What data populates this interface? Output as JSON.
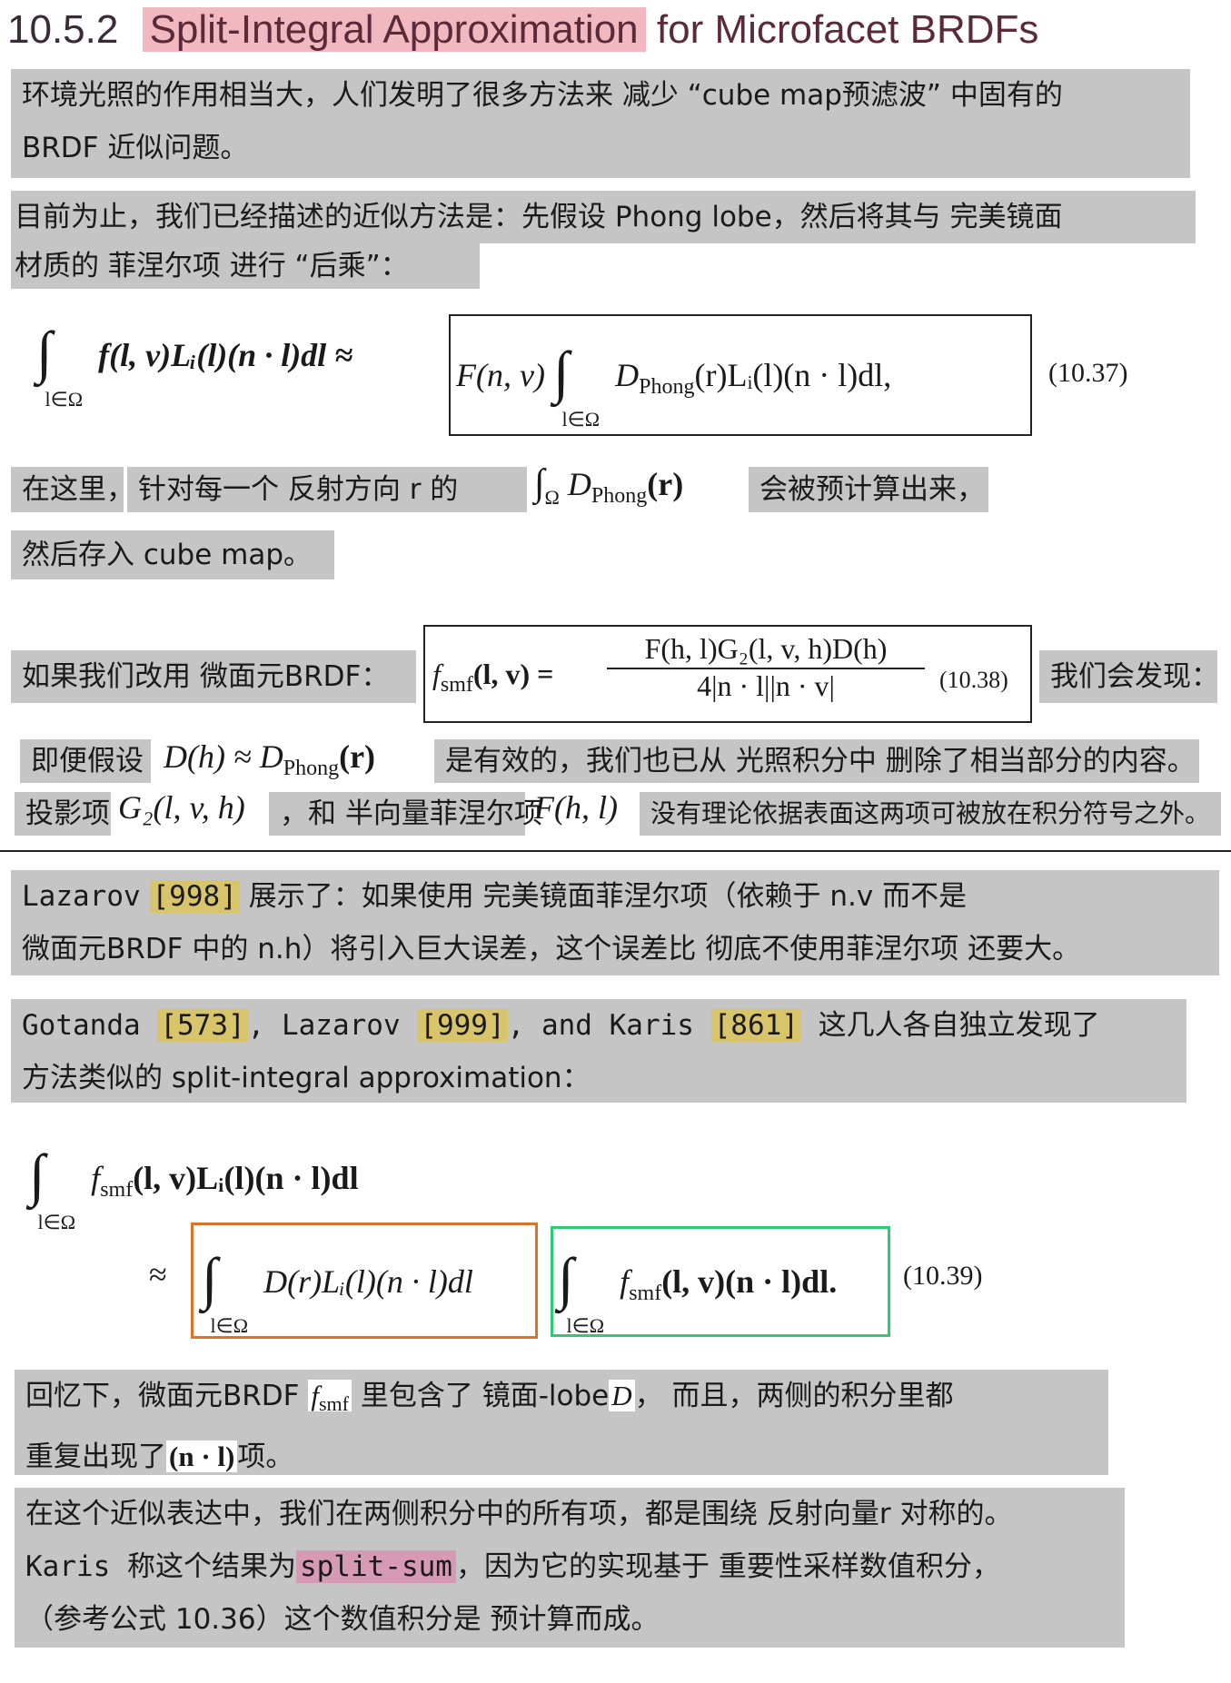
{
  "heading": {
    "number": "10.5.2",
    "title_highlight": "Split-Integral Approximation",
    "title_rest": "for Microfacet BRDFs"
  },
  "p1": {
    "line1": "环境光照的作用相当大，人们发明了很多方法来 减少 “cube map预滤波” 中固有的",
    "line2": "BRDF 近似问题。"
  },
  "p2": {
    "line1": "目前为止，我们已经描述的近似方法是：先假设 Phong lobe，然后将其与 完美镜面",
    "line2": "材质的 菲涅尔项 进行 “后乘”："
  },
  "eq1": {
    "lhs": "f(l, v)Lᵢ(l)(n · l)dl ≈",
    "int_sub": "l∈Ω",
    "box_prefix": "F(n, v)",
    "box_body_pre": "D",
    "box_body_sub": "Phong",
    "box_body_post": "(r)Lᵢ(l)(n · l)dl,",
    "number": "(10.37)"
  },
  "p3": {
    "seg1": "在这里，",
    "seg2": "针对每一个 反射方向 r 的",
    "math_sub": "Ω",
    "math_D": "D",
    "math_Dsub": "Phong",
    "math_r": "(r)",
    "seg3": "会被预计算出来，",
    "line2": "然后存入 cube map。"
  },
  "p4": {
    "pre": "如果我们改用 微面元BRDF：",
    "lhs": "(l, v) =",
    "f_sub": "smf",
    "numerator": "F(h, l)G₂(l, v, h)D(h)",
    "denominator": "4|n · l||n · v|",
    "number": "(10.38)",
    "post": "我们会发现："
  },
  "p5": {
    "seg1": "即便假设",
    "math": "D(h) ≈ D",
    "math_sub": "Phong",
    "math_post": "(r)",
    "seg2": "是有效的，我们也已从 光照积分中 删除了相当部分的内容。"
  },
  "p6": {
    "seg1": "投影项",
    "math1": "G₂(l, v, h)",
    "seg2": "，和 半向量菲涅尔项",
    "math2": "F(h, l)",
    "seg3": "没有理论依据表面这两项可被放在积分符号之外。"
  },
  "p7": {
    "l1_a": "Lazarov",
    "l1_cite": "[998]",
    "l1_b": "展示了：如果使用 完美镜面菲涅尔项（依赖于 n.v 而不是",
    "line2": "微面元BRDF 中的 n.h）将引入巨大误差，这个误差比 彻底不使用菲涅尔项 还要大。"
  },
  "p8": {
    "a": "Gotanda",
    "c1": "[573]",
    "b": ", Lazarov",
    "c2": "[999]",
    "c": ", and Karis",
    "c3": "[861]",
    "d": "这几人各自独立发现了",
    "line2": "方法类似的 split-integral approximation："
  },
  "eq3": {
    "line1_f": "f",
    "line1_fsub": "smf",
    "line1_rest": "(l, v)Lᵢ(l)(n · l)dl",
    "int_sub": "l∈Ω",
    "approx": "≈",
    "box1": "D(r)Lᵢ(l)(n · l)dl",
    "box2_f": "f",
    "box2_sub": "smf",
    "box2_rest": "(l, v)(n · l)dl.",
    "number": "(10.39)",
    "color_orange": "#d9742a",
    "color_green": "#2ecc71"
  },
  "p9": {
    "a": "回忆下，微面元BRDF",
    "f": "f",
    "fsub": "smf",
    "b": "里包含了 镜面-lobe",
    "D": "D",
    "c": "，  而且，两侧的积分里都",
    "line2_a": "重复出现了",
    "line2_math": "(n · l)",
    "line2_b": "项。"
  },
  "p10": {
    "line1": "在这个近似表达中，我们在两侧积分中的所有项，都是围绕 反射向量r 对称的。",
    "l2_a": "Karis 称这个结果为",
    "l2_hl": "split-sum",
    "l2_b": "，因为它的实现基于 重要性采样数值积分，",
    "line3": "（参考公式 10.36）这个数值积分是 预计算而成。"
  },
  "colors": {
    "block_gray": "#c5c5c5",
    "title_pink": "#f2b8bf",
    "cite_yellow": "#d8c46a",
    "split_sum_pink": "#d79ab4"
  }
}
